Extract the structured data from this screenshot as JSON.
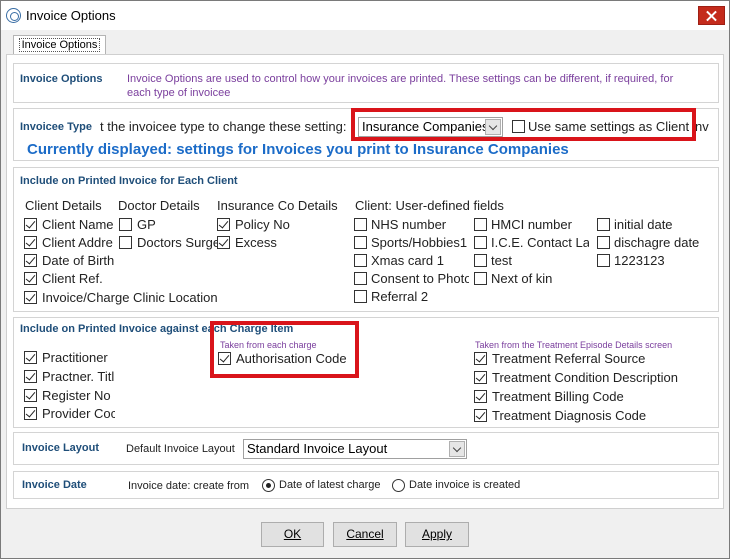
{
  "window": {
    "title": "Invoice Options"
  },
  "tab": {
    "label": "Invoice Options"
  },
  "intro": {
    "title": "Invoice Options",
    "description": "Invoice Options are used to control how your invoices are printed. These settings can be different, if required, for each type of invoicee"
  },
  "invoicee_type": {
    "title": "Invoicee Type",
    "instruction": "t the invoicee type to change these setting:",
    "selected": "Insurance Companies",
    "same_settings_label": "Use same settings as Client",
    "trailing_fragment": "nv",
    "banner": "Currently displayed: settings for Invoices you print to Insurance Companies"
  },
  "each_client": {
    "title": "Include on Printed Invoice for Each Client",
    "client_details": {
      "heading": "Client Details",
      "items": [
        {
          "label": "Client Name",
          "checked": true
        },
        {
          "label": "Client Addre",
          "checked": true
        },
        {
          "label": "Date of Birth",
          "checked": true
        },
        {
          "label": "Client Ref.",
          "checked": true
        },
        {
          "label": "Invoice/Charge Clinic Location",
          "checked": true
        }
      ]
    },
    "doctor_details": {
      "heading": "Doctor Details",
      "items": [
        {
          "label": "GP",
          "checked": false
        },
        {
          "label": "Doctors Surge",
          "checked": false
        }
      ]
    },
    "insurance_details": {
      "heading": "Insurance Co Details",
      "items": [
        {
          "label": "Policy No",
          "checked": true
        },
        {
          "label": "Excess",
          "checked": true
        }
      ]
    },
    "user_defined": {
      "heading": "Client: User-defined fields",
      "col1": [
        {
          "label": "NHS number",
          "checked": false
        },
        {
          "label": "Sports/Hobbies1",
          "checked": false
        },
        {
          "label": "Xmas card 1",
          "checked": false
        },
        {
          "label": "Consent to Photo",
          "checked": false
        },
        {
          "label": "Referral 2",
          "checked": false
        }
      ],
      "col2": [
        {
          "label": "HMCI number",
          "checked": false
        },
        {
          "label": "I.C.E. Contact Lar",
          "checked": false
        },
        {
          "label": "test",
          "checked": false
        },
        {
          "label": "Next of kin",
          "checked": false
        }
      ],
      "col3": [
        {
          "label": "initial date",
          "checked": false
        },
        {
          "label": "dischagre date",
          "checked": false
        },
        {
          "label": "1223123",
          "checked": false
        }
      ]
    }
  },
  "charge_items": {
    "title": "Include on Printed Invoice against each Charge Item",
    "col1": [
      {
        "label": "Practitioner",
        "checked": true
      },
      {
        "label": "Practner. Titl",
        "checked": true
      },
      {
        "label": "Register No",
        "checked": true
      },
      {
        "label": "Provider Coc",
        "checked": true
      }
    ],
    "each_charge_note": "Taken from each charge",
    "each_charge": [
      {
        "label": "Authorisation Code",
        "checked": true
      }
    ],
    "episode_note": "Taken from the Treatment Episode Details screen",
    "episode": [
      {
        "label": "Treatment Referral Source",
        "checked": true
      },
      {
        "label": "Treatment Condition Description",
        "checked": true
      },
      {
        "label": "Treatment Billing Code",
        "checked": true
      },
      {
        "label": "Treatment Diagnosis Code",
        "checked": true
      }
    ]
  },
  "layout": {
    "title": "Invoice Layout",
    "label": "Default Invoice Layout",
    "selected": "Standard Invoice Layout"
  },
  "date": {
    "title": "Invoice Date",
    "label": "Invoice date: create from",
    "option1": "Date of latest charge",
    "option2": "Date invoice is created",
    "selected": "option1"
  },
  "buttons": {
    "ok": "OK",
    "cancel": "Cancel",
    "apply": "Apply"
  },
  "colors": {
    "highlight": "#d9141a",
    "banner": "#1c6cc8",
    "section_title": "#1f4e79",
    "description": "#7a3e9d"
  }
}
